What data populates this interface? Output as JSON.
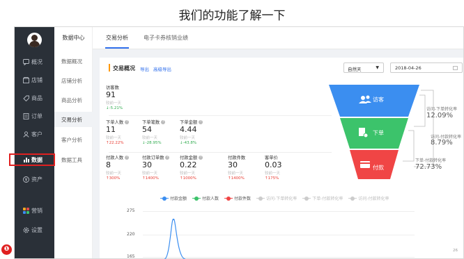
{
  "slide": {
    "title": "我们的功能了解一下"
  },
  "sidebar": {
    "items": [
      {
        "label": "概况",
        "icon": "message-icon"
      },
      {
        "label": "店铺",
        "icon": "store-icon"
      },
      {
        "label": "商品",
        "icon": "tag-icon"
      },
      {
        "label": "订单",
        "icon": "order-icon"
      },
      {
        "label": "客户",
        "icon": "user-icon"
      },
      {
        "label": "数据",
        "icon": "bar-chart-icon"
      },
      {
        "label": "资产",
        "icon": "yen-icon"
      },
      {
        "label": "营销",
        "icon": "grid-icon"
      },
      {
        "label": "设置",
        "icon": "gear-icon"
      }
    ],
    "active": "数据"
  },
  "subnav": {
    "title": "数据中心",
    "items": [
      "数据概况",
      "店铺分析",
      "商品分析",
      "交易分析",
      "客户分析",
      "数据工具"
    ],
    "active": "交易分析"
  },
  "tabs": [
    "交易分析",
    "电子卡券核销业绩"
  ],
  "overview": {
    "title": "交易概况",
    "export": "导出",
    "advanced_export": "高级导出",
    "period": "自然天",
    "date": "2018-04-26"
  },
  "metrics": {
    "visitors": {
      "label": "访客数",
      "value": "91",
      "compare": "较前一天",
      "change": "-5.21%"
    },
    "order_users": {
      "label": "下单人数",
      "value": "11",
      "compare": "较前一天",
      "change": "22.22%"
    },
    "order_count": {
      "label": "下单笔数",
      "value": "54",
      "compare": "较前一天",
      "change": "-28.95%"
    },
    "order_amount": {
      "label": "下单金额",
      "value": "4.44",
      "compare": "较前一天",
      "change": "-43.8%"
    },
    "pay_users": {
      "label": "付款人数",
      "value": "8",
      "compare": "较前一天",
      "change": "300%"
    },
    "pay_orders": {
      "label": "付款订单数",
      "value": "30",
      "compare": "较前一天",
      "change": "1400%"
    },
    "pay_amount": {
      "label": "付款金额",
      "value": "0.22",
      "compare": "较前一天",
      "change": "1000%"
    },
    "pay_items": {
      "label": "付款件数",
      "value": "30",
      "compare": "较前一天",
      "change": "1400%"
    },
    "unit_price": {
      "label": "客单价",
      "value": "0.03",
      "compare": "较前一天",
      "change": "175%"
    }
  },
  "funnel": {
    "stages": [
      {
        "label": "访客",
        "color": "#3b8ef0"
      },
      {
        "label": "下单",
        "color": "#3cc36b"
      },
      {
        "label": "付款",
        "color": "#f04545"
      }
    ],
    "rates": [
      {
        "label": "访问-下单转化率",
        "value": "12.09%"
      },
      {
        "label": "访问-付款转化率",
        "value": "8.79%"
      },
      {
        "label": "下单-付款转化率",
        "value": "72.73%"
      }
    ]
  },
  "chart_data": {
    "type": "line",
    "legend": [
      {
        "name": "付款金额",
        "color": "#3b8ef0"
      },
      {
        "name": "付款人数",
        "color": "#3cc36b"
      },
      {
        "name": "付款件数",
        "color": "#f04545"
      },
      {
        "name": "访问-下单转化率",
        "color": "#cccccc"
      },
      {
        "name": "下单-付款转化率",
        "color": "#cccccc"
      },
      {
        "name": "访问-付款转化率",
        "color": "#cccccc"
      }
    ],
    "yticks": [
      "275",
      "220",
      "165"
    ],
    "page": "26"
  }
}
